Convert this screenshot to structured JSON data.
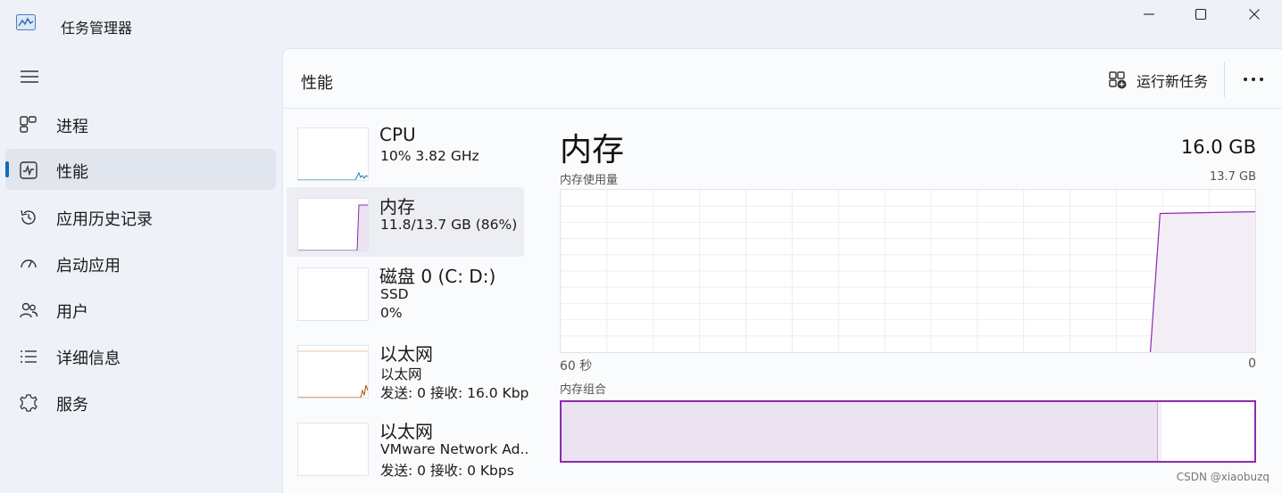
{
  "window": {
    "title": "任务管理器"
  },
  "sidebar": {
    "items": [
      {
        "label": "进程",
        "icon": "processes-icon"
      },
      {
        "label": "性能",
        "icon": "performance-icon",
        "active": true
      },
      {
        "label": "应用历史记录",
        "icon": "history-icon"
      },
      {
        "label": "启动应用",
        "icon": "startup-icon"
      },
      {
        "label": "用户",
        "icon": "users-icon"
      },
      {
        "label": "详细信息",
        "icon": "details-icon"
      },
      {
        "label": "服务",
        "icon": "services-icon"
      }
    ]
  },
  "header": {
    "title": "性能",
    "run_task_label": "运行新任务"
  },
  "resources": [
    {
      "name": "CPU",
      "lines": [
        "10%  3.82 GHz"
      ],
      "color": "#117dbb"
    },
    {
      "name": "内存",
      "lines": [
        "11.8/13.7 GB (86%)"
      ],
      "color": "#8b2bab",
      "active": true
    },
    {
      "name": "磁盘 0 (C: D:)",
      "lines": [
        "SSD",
        "0%"
      ],
      "color": "#4da60c"
    },
    {
      "name": "以太网",
      "lines": [
        "以太网",
        "发送: 0 接收: 16.0 Kbps"
      ],
      "color": "#a74f01"
    },
    {
      "name": "以太网",
      "lines": [
        "VMware Network Ad..",
        "发送: 0 接收: 0 Kbps"
      ],
      "color": "#a74f01"
    }
  ],
  "detail": {
    "title": "内存",
    "total": "16.0 GB",
    "usage_label": "内存使用量",
    "usage_max": "13.7 GB",
    "axis_left": "60 秒",
    "axis_right": "0",
    "composition_label": "内存组合",
    "usage_fraction": 0.86,
    "modified_fraction": 0.005
  },
  "colors": {
    "memory": "#8b2bab",
    "memory_fill": "#ece3f1",
    "accent": "#0f6cbd"
  },
  "watermark": "CSDN @xiaobuzq"
}
